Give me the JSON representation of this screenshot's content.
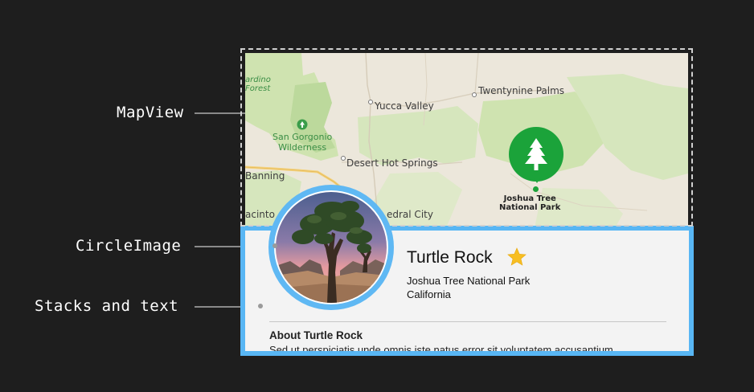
{
  "annotations": {
    "mapview": "MapView",
    "circle_image": "CircleImage",
    "stacks": "Stacks and text"
  },
  "map": {
    "labels": {
      "forest_line1": "ardino",
      "forest_line2": "Forest",
      "twentynine_palms": "Twentynine Palms",
      "yucca_valley": "Yucca Valley",
      "san_gorgonio_line1": "San Gorgonio",
      "san_gorgonio_line2": "Wilderness",
      "desert_hot_springs": "Desert Hot Springs",
      "banning": "Banning",
      "jacinto": "acinto",
      "cathedral_city": "edral City"
    },
    "pin": {
      "name_line1": "Joshua Tree",
      "name_line2": "National Park",
      "icon": "tree-icon",
      "color": "#1ba33a"
    }
  },
  "card": {
    "title": "Turtle Rock",
    "favorite_icon": "star-icon",
    "park": "Joshua Tree National Park",
    "state": "California",
    "about_heading": "About Turtle Rock",
    "about_text": "Sed ut perspiciatis unde omnis iste natus error sit voluptatem accusantium",
    "accent_color": "#58b6f4"
  }
}
